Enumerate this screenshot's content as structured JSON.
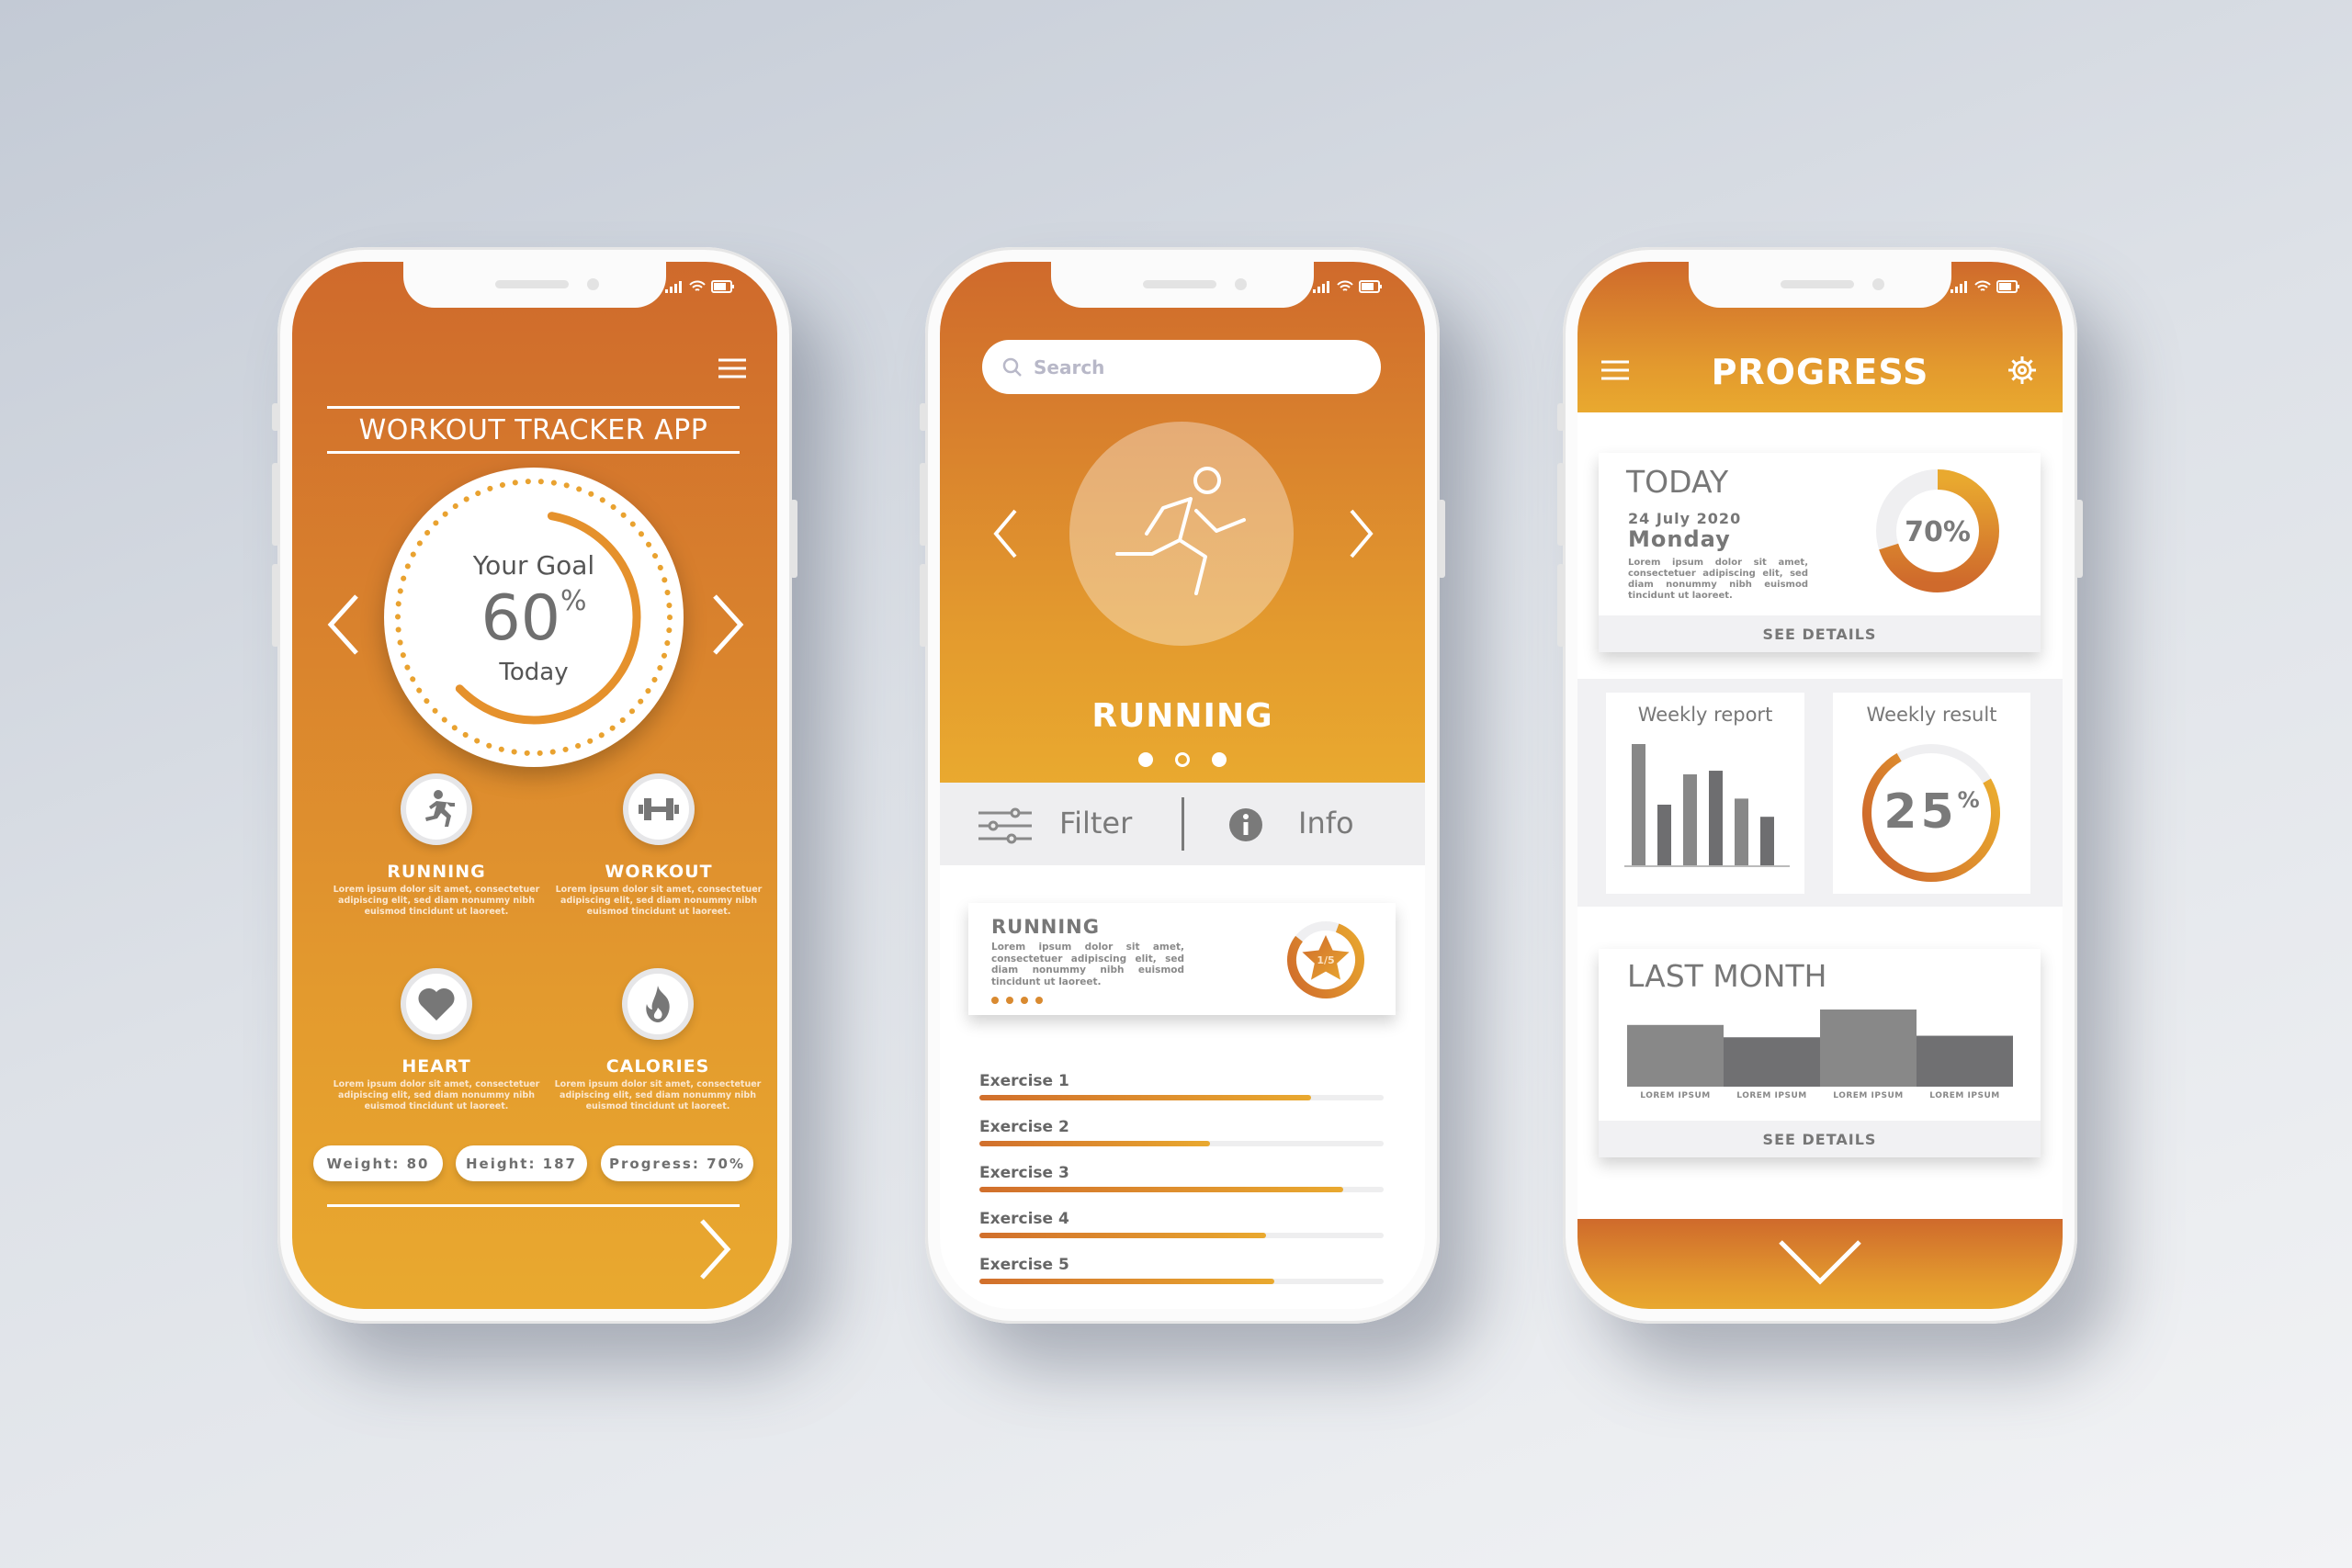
{
  "colors": {
    "accent_dark": "#cf6a2c",
    "accent_light": "#e9a92f",
    "text_grey": "#7a7a7a"
  },
  "phone1": {
    "title": "WORKOUT TRACKER APP",
    "goal": {
      "label": "Your Goal",
      "value": "60",
      "unit": "%",
      "sub": "Today",
      "percent": 60
    },
    "features": [
      {
        "icon": "running-icon",
        "title": "RUNNING",
        "desc": "Lorem ipsum dolor sit amet, consectetuer adipiscing elit, sed diam nonummy nibh euismod tincidunt ut laoreet."
      },
      {
        "icon": "dumbbell-icon",
        "title": "WORKOUT",
        "desc": "Lorem ipsum dolor sit amet, consectetuer adipiscing elit, sed diam nonummy nibh euismod tincidunt ut laoreet."
      },
      {
        "icon": "heart-icon",
        "title": "HEART",
        "desc": "Lorem ipsum dolor sit amet, consectetuer adipiscing elit, sed diam nonummy nibh euismod tincidunt ut laoreet."
      },
      {
        "icon": "flame-icon",
        "title": "CALORIES",
        "desc": "Lorem ipsum dolor sit amet, consectetuer adipiscing elit, sed diam nonummy nibh euismod tincidunt ut laoreet."
      }
    ],
    "stats": [
      "Weight: 80",
      "Height: 187",
      "Progress: 70%"
    ]
  },
  "phone2": {
    "search_placeholder": "Search",
    "activity": "RUNNING",
    "carousel": {
      "count": 3,
      "active": 1
    },
    "filter_label": "Filter",
    "info_label": "Info",
    "card": {
      "title": "RUNNING",
      "desc": "Lorem ipsum dolor sit amet, consectetuer adipiscing elit, sed diam nonummy nibh euismod tincidunt ut laoreet.",
      "rating": "1/5",
      "rating_fraction": 0.8
    },
    "exercises": [
      {
        "label": "Exercise 1",
        "progress": 0.82
      },
      {
        "label": "Exercise 2",
        "progress": 0.57
      },
      {
        "label": "Exercise 3",
        "progress": 0.9
      },
      {
        "label": "Exercise 4",
        "progress": 0.71
      },
      {
        "label": "Exercise 5",
        "progress": 0.73
      }
    ]
  },
  "phone3": {
    "title": "PROGRESS",
    "today": {
      "heading": "TODAY",
      "date": "24 July 2020",
      "day": "Monday",
      "desc": "Lorem ipsum dolor sit amet, consectetuer adipiscing elit, sed diam nonummy nibh euismod tincidunt ut laoreet.",
      "percent_label": "70%",
      "percent": 70,
      "details": "SEE DETAILS"
    },
    "weekly_report": {
      "title": "Weekly report",
      "values": [
        100,
        50,
        75,
        78,
        55,
        40
      ]
    },
    "weekly_result": {
      "title": "Weekly result",
      "value": "25",
      "unit": "%",
      "percent": 75
    },
    "last_month": {
      "heading": "LAST MONTH",
      "categories": [
        "LOREM IPSUM",
        "LOREM IPSUM",
        "LOREM IPSUM",
        "LOREM IPSUM"
      ],
      "values": [
        80,
        64,
        100,
        66
      ],
      "details": "SEE DETAILS"
    }
  }
}
